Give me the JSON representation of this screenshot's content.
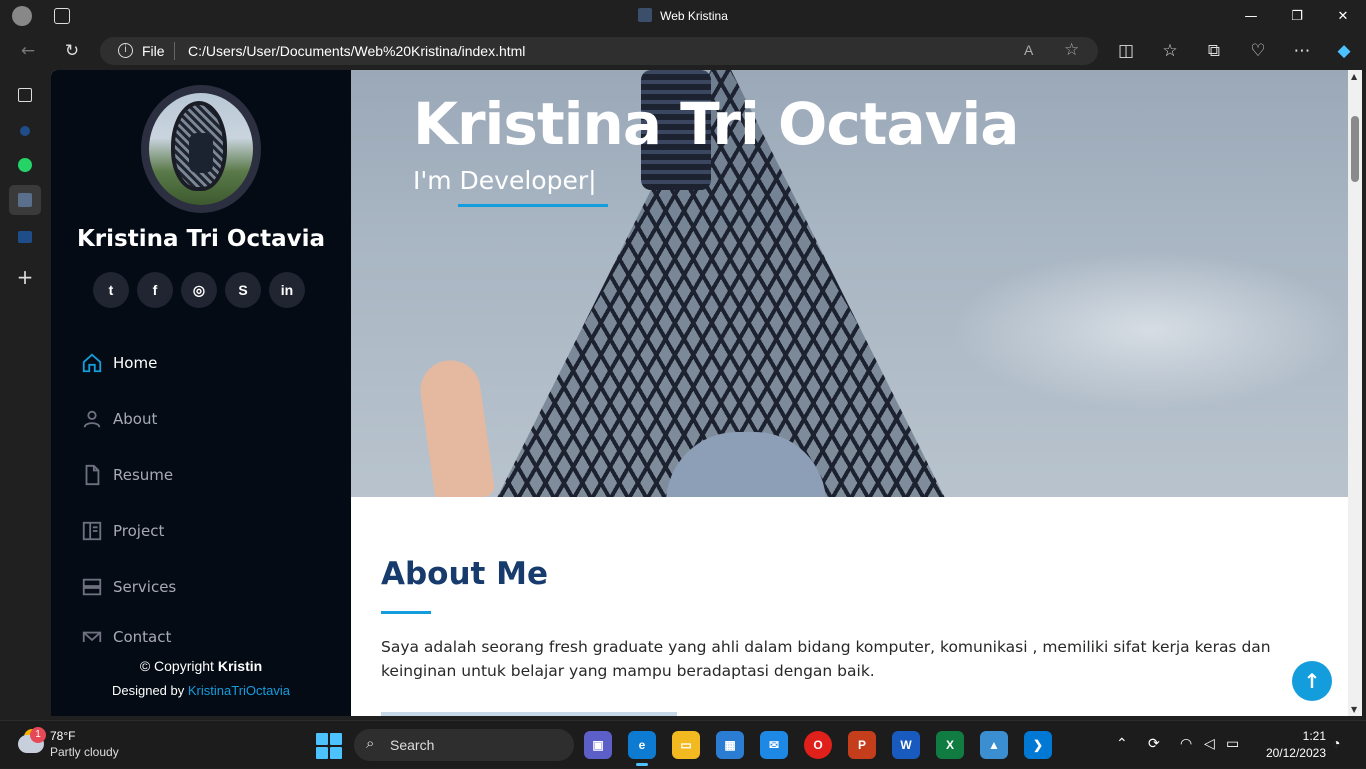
{
  "window": {
    "title": "Web Kristina"
  },
  "browser": {
    "url_prefix": "File",
    "url": "C:/Users/User/Documents/Web%20Kristina/index.html",
    "read_aloud": "A"
  },
  "sidebar": {
    "name": "Kristina Tri Octavia",
    "social": [
      {
        "icon": "twitter-icon",
        "glyph": "t"
      },
      {
        "icon": "facebook-icon",
        "glyph": "f"
      },
      {
        "icon": "instagram-icon",
        "glyph": "◎"
      },
      {
        "icon": "skype-icon",
        "glyph": "S"
      },
      {
        "icon": "linkedin-icon",
        "glyph": "in"
      }
    ],
    "menu": [
      {
        "label": "Home",
        "icon": "house-icon",
        "active": true
      },
      {
        "label": "About",
        "icon": "person-icon",
        "active": false
      },
      {
        "label": "Resume",
        "icon": "file-icon",
        "active": false
      },
      {
        "label": "Project",
        "icon": "book-icon",
        "active": false
      },
      {
        "label": "Services",
        "icon": "server-icon",
        "active": false
      },
      {
        "label": "Contact",
        "icon": "envelope-icon",
        "active": false
      }
    ],
    "copyright_prefix": "© Copyright",
    "copyright_name": "Kristin",
    "designed_by": "Designed by",
    "designer_link": "KristinaTriOctavia"
  },
  "hero": {
    "title": "Kristina Tri Octavia",
    "subtitle": "I'm Developer|"
  },
  "about": {
    "heading": "About Me",
    "text": "Saya adalah seorang fresh graduate yang ahli dalam bidang komputer, komunikasi , memiliki sifat kerja keras dan keinginan untuk belajar yang mampu beradaptasi dengan baik."
  },
  "taskbar": {
    "weather_temp": "78°F",
    "weather_desc": "Partly cloudy",
    "weather_badge": "1",
    "search_label": "Search",
    "time": "1:21",
    "date": "20/12/2023"
  },
  "colors": {
    "accent": "#149ddd",
    "sidebar_bg": "#040b14",
    "heading": "#173b6c"
  }
}
